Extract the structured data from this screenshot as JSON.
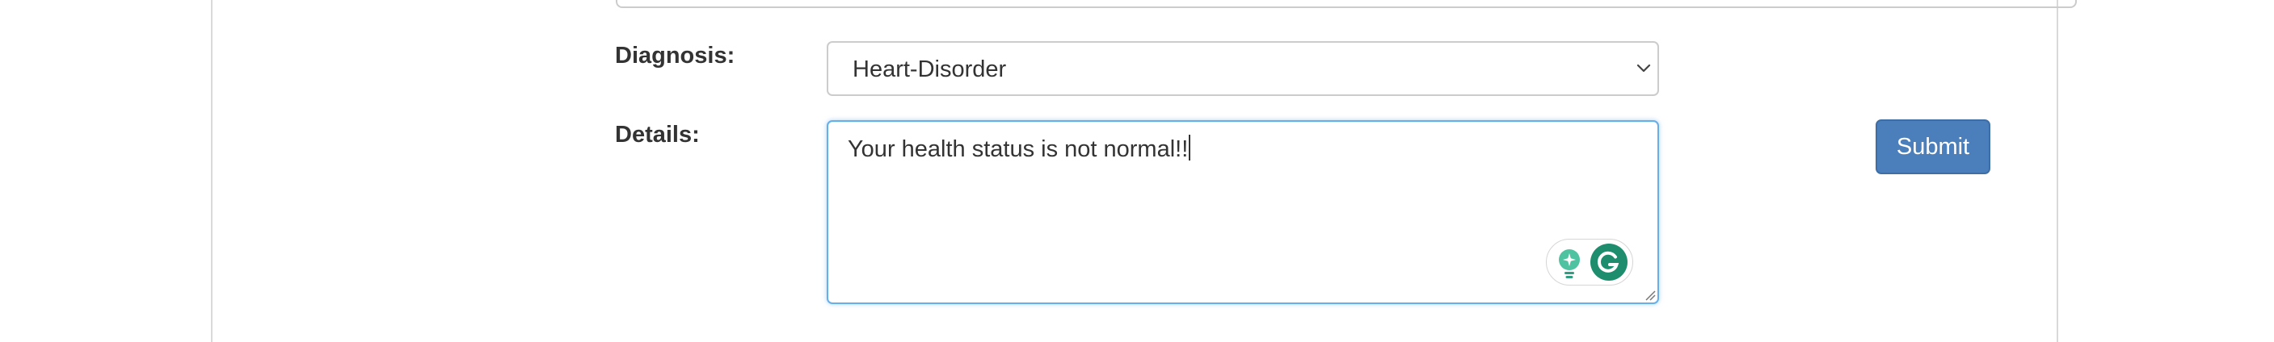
{
  "form": {
    "diagnosis": {
      "label": "Diagnosis:",
      "selected": "Heart-Disorder"
    },
    "details": {
      "label": "Details:",
      "value": "Your health status is not normal!!"
    },
    "submit_label": "Submit"
  },
  "icons": {
    "select_chevron": "chevron-down-icon",
    "grammarly_suggestion": "lightbulb-icon",
    "grammarly_logo": "grammarly-g-icon",
    "textarea_resize": "resize-handle-icon"
  },
  "colors": {
    "submit_bg": "#4a7fbc",
    "focus_border": "#66afe9",
    "grammarly_green": "#1d8d6e"
  }
}
